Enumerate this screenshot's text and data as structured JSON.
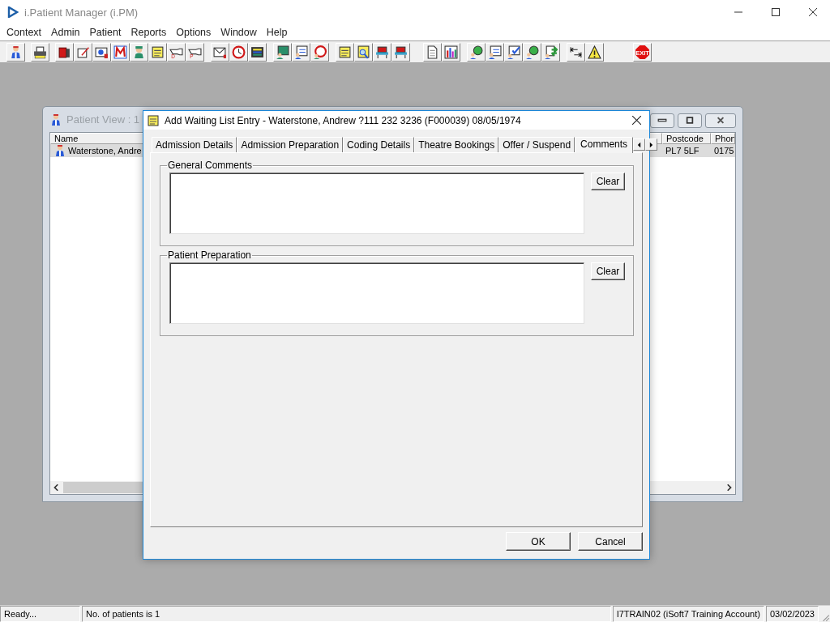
{
  "app": {
    "title": "i.Patient Manager (i.PM)"
  },
  "menu": [
    "Context",
    "Admin",
    "Patient",
    "Reports",
    "Options",
    "Window",
    "Help"
  ],
  "toolbar": [
    {
      "buttons": [
        {
          "kind": "person"
        }
      ]
    },
    {
      "buttons": [
        {
          "kind": "printer"
        }
      ]
    },
    {
      "buttons": [
        {
          "kind": "book"
        },
        {
          "kind": "pen"
        },
        {
          "kind": "card"
        },
        {
          "kind": "zigzag"
        },
        {
          "kind": "surgeon"
        },
        {
          "kind": "note"
        },
        {
          "kind": "hand",
          "label": "D"
        },
        {
          "kind": "hand",
          "label": "P"
        }
      ]
    },
    {
      "buttons": [
        {
          "kind": "mail"
        },
        {
          "kind": "clock"
        },
        {
          "kind": "screen"
        }
      ]
    },
    {
      "buttons": [
        {
          "kind": "monitor"
        },
        {
          "kind": "form"
        },
        {
          "kind": "stopwatch"
        }
      ]
    },
    {
      "buttons": [
        {
          "kind": "note"
        },
        {
          "kind": "search"
        },
        {
          "kind": "chair"
        },
        {
          "kind": "chair"
        }
      ]
    },
    {
      "buttons": [
        {
          "kind": "page"
        },
        {
          "kind": "chart"
        }
      ]
    },
    {
      "buttons": [
        {
          "kind": "globe"
        },
        {
          "kind": "form"
        },
        {
          "kind": "check"
        },
        {
          "kind": "globe"
        },
        {
          "kind": "transfer"
        }
      ]
    },
    {
      "buttons": [
        {
          "kind": "tab"
        },
        {
          "kind": "warning"
        }
      ]
    },
    {
      "buttons": [
        {
          "kind": "stop",
          "label": "EXIT"
        }
      ]
    }
  ],
  "patient_view": {
    "title": "Patient View : 1",
    "columns": [
      "Name",
      "Postcode",
      "Phon"
    ],
    "rows": [
      {
        "name": "Waterstone, Andre",
        "postcode": "PL7 5LF",
        "phone": "0175",
        "selected": true
      }
    ]
  },
  "dialog": {
    "title": "Add Waiting List Entry - Waterstone, Andrew ?111 232 3236 (F000039) 08/05/1974",
    "tabs": [
      {
        "label": "Admission Details",
        "selected": false
      },
      {
        "label": "Admission Preparation",
        "selected": false
      },
      {
        "label": "Coding Details",
        "selected": false
      },
      {
        "label": "Theatre Bookings",
        "selected": false
      },
      {
        "label": "Offer / Suspend",
        "selected": false
      },
      {
        "label": "Comments",
        "selected": true
      }
    ],
    "groups": [
      {
        "label": "General Comments",
        "button": "Clear"
      },
      {
        "label": "Patient Preparation",
        "button": "Clear"
      }
    ],
    "buttons": [
      "OK",
      "Cancel"
    ]
  },
  "status_bar": [
    "Ready...",
    "No. of patients is 1",
    "I7TRAIN02 (iSoft7 Training Account)",
    "03/02/2023"
  ]
}
